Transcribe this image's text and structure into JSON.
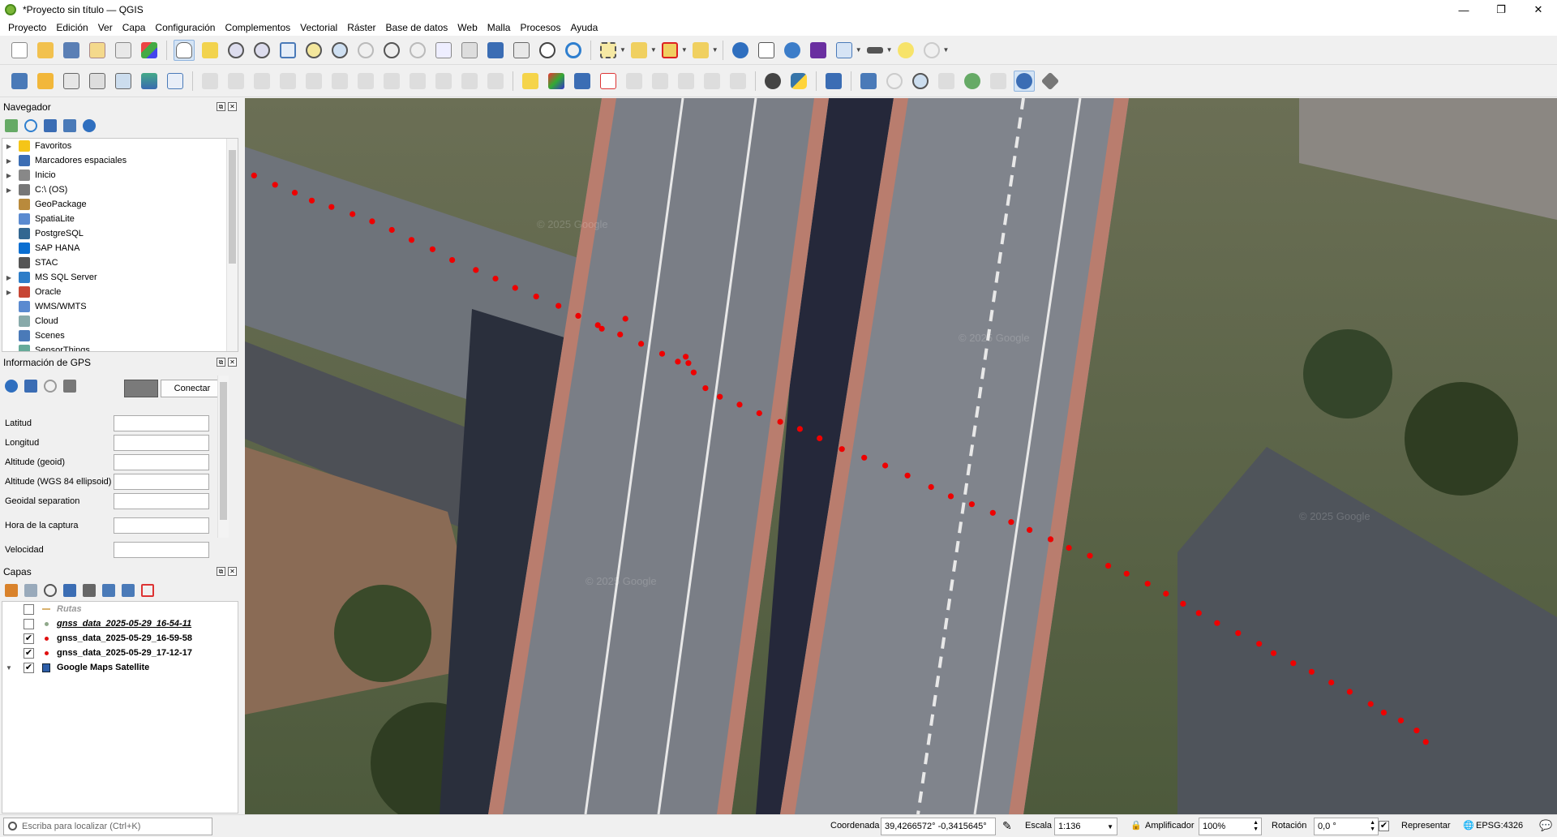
{
  "window": {
    "title": "*Proyecto sin título — QGIS",
    "minimize": "—",
    "maximize": "❐",
    "close": "✕"
  },
  "menu": [
    "Proyecto",
    "Edición",
    "Ver",
    "Capa",
    "Configuración",
    "Complementos",
    "Vectorial",
    "Ráster",
    "Base de datos",
    "Web",
    "Malla",
    "Procesos",
    "Ayuda"
  ],
  "navigator": {
    "title": "Navegador",
    "items": [
      {
        "label": "Favoritos",
        "icon": "star-icon",
        "expandable": true
      },
      {
        "label": "Marcadores espaciales",
        "icon": "bookmark-icon",
        "expandable": true
      },
      {
        "label": "Inicio",
        "icon": "home-folder-icon",
        "expandable": true
      },
      {
        "label": "C:\\ (OS)",
        "icon": "drive-icon",
        "expandable": true
      },
      {
        "label": "GeoPackage",
        "icon": "geopackage-icon",
        "expandable": false
      },
      {
        "label": "SpatiaLite",
        "icon": "spatialite-icon",
        "expandable": false
      },
      {
        "label": "PostgreSQL",
        "icon": "postgresql-icon",
        "expandable": false
      },
      {
        "label": "SAP HANA",
        "icon": "sap-hana-icon",
        "expandable": false
      },
      {
        "label": "STAC",
        "icon": "stac-icon",
        "expandable": false
      },
      {
        "label": "MS SQL Server",
        "icon": "mssql-icon",
        "expandable": true
      },
      {
        "label": "Oracle",
        "icon": "oracle-icon",
        "expandable": true
      },
      {
        "label": "WMS/WMTS",
        "icon": "wms-icon",
        "expandable": false
      },
      {
        "label": "Cloud",
        "icon": "cloud-icon",
        "expandable": false
      },
      {
        "label": "Scenes",
        "icon": "scenes-icon",
        "expandable": false
      },
      {
        "label": "SensorThings",
        "icon": "sensorthings-icon",
        "expandable": false
      }
    ]
  },
  "gps": {
    "title": "Información de GPS",
    "connect_button": "Conectar",
    "fields": [
      "Latitud",
      "Longitud",
      "Altitude (geoid)",
      "Altitude (WGS 84 ellipsoid)",
      "Geoidal separation",
      "Hora de la captura",
      "Velocidad"
    ]
  },
  "layers": {
    "title": "Capas",
    "items": [
      {
        "name": "Rutas",
        "checked": false,
        "italic": true,
        "symbol": "line",
        "color": "#d9b26f"
      },
      {
        "name": "gnss_data_2025-05-29_16-54-11",
        "checked": false,
        "italic": true,
        "underline": true,
        "symbol": "point",
        "color": "#8fa88a"
      },
      {
        "name": "gnss_data_2025-05-29_16-59-58",
        "checked": true,
        "italic": false,
        "symbol": "point",
        "color": "#e01010"
      },
      {
        "name": "gnss_data_2025-05-29_17-12-17",
        "checked": true,
        "italic": false,
        "symbol": "point",
        "color": "#e01010"
      },
      {
        "name": "Google Maps Satellite",
        "checked": true,
        "italic": false,
        "symbol": "raster",
        "color": "#2d5ea8",
        "expandable": true
      }
    ]
  },
  "map": {
    "watermark": "© 2025 Google",
    "track_color": "#ee0000",
    "track_points": [
      [
        0.007,
        0.108
      ],
      [
        0.023,
        0.121
      ],
      [
        0.038,
        0.132
      ],
      [
        0.051,
        0.143
      ],
      [
        0.066,
        0.152
      ],
      [
        0.082,
        0.162
      ],
      [
        0.097,
        0.172
      ],
      [
        0.112,
        0.184
      ],
      [
        0.127,
        0.198
      ],
      [
        0.143,
        0.211
      ],
      [
        0.158,
        0.226
      ],
      [
        0.176,
        0.24
      ],
      [
        0.191,
        0.252
      ],
      [
        0.206,
        0.265
      ],
      [
        0.222,
        0.277
      ],
      [
        0.239,
        0.29
      ],
      [
        0.254,
        0.304
      ],
      [
        0.269,
        0.317
      ],
      [
        0.286,
        0.33
      ],
      [
        0.302,
        0.343
      ],
      [
        0.318,
        0.357
      ],
      [
        0.33,
        0.368
      ],
      [
        0.342,
        0.383
      ],
      [
        0.351,
        0.405
      ],
      [
        0.362,
        0.417
      ],
      [
        0.377,
        0.428
      ],
      [
        0.392,
        0.44
      ],
      [
        0.408,
        0.452
      ],
      [
        0.423,
        0.462
      ],
      [
        0.438,
        0.475
      ],
      [
        0.455,
        0.49
      ],
      [
        0.472,
        0.502
      ],
      [
        0.488,
        0.513
      ],
      [
        0.505,
        0.527
      ],
      [
        0.523,
        0.543
      ],
      [
        0.538,
        0.556
      ],
      [
        0.554,
        0.567
      ],
      [
        0.57,
        0.579
      ],
      [
        0.584,
        0.592
      ],
      [
        0.598,
        0.603
      ],
      [
        0.614,
        0.616
      ],
      [
        0.628,
        0.628
      ],
      [
        0.644,
        0.639
      ],
      [
        0.658,
        0.653
      ],
      [
        0.672,
        0.664
      ],
      [
        0.688,
        0.678
      ],
      [
        0.702,
        0.692
      ],
      [
        0.715,
        0.706
      ],
      [
        0.727,
        0.719
      ],
      [
        0.741,
        0.733
      ],
      [
        0.757,
        0.747
      ],
      [
        0.773,
        0.762
      ],
      [
        0.784,
        0.775
      ],
      [
        0.799,
        0.789
      ],
      [
        0.813,
        0.801
      ],
      [
        0.828,
        0.816
      ],
      [
        0.842,
        0.829
      ],
      [
        0.858,
        0.846
      ],
      [
        0.868,
        0.858
      ],
      [
        0.881,
        0.869
      ],
      [
        0.893,
        0.883
      ],
      [
        0.9,
        0.899
      ]
    ],
    "extra_points": [
      [
        0.272,
        0.322
      ],
      [
        0.29,
        0.308
      ],
      [
        0.336,
        0.361
      ],
      [
        0.338,
        0.37
      ]
    ]
  },
  "status": {
    "locator_placeholder": "Escriba para localizar (Ctrl+K)",
    "coordinate_label": "Coordenada",
    "coordinate_value": "39,4266572° -0,3415645°",
    "scale_label": "Escala",
    "scale_value": "1:136",
    "magnifier_label": "Amplificador",
    "magnifier_value": "100%",
    "rotation_label": "Rotación",
    "rotation_value": "0,0 °",
    "render_label": "Representar",
    "render_checked": true,
    "crs": "EPSG:4326"
  }
}
